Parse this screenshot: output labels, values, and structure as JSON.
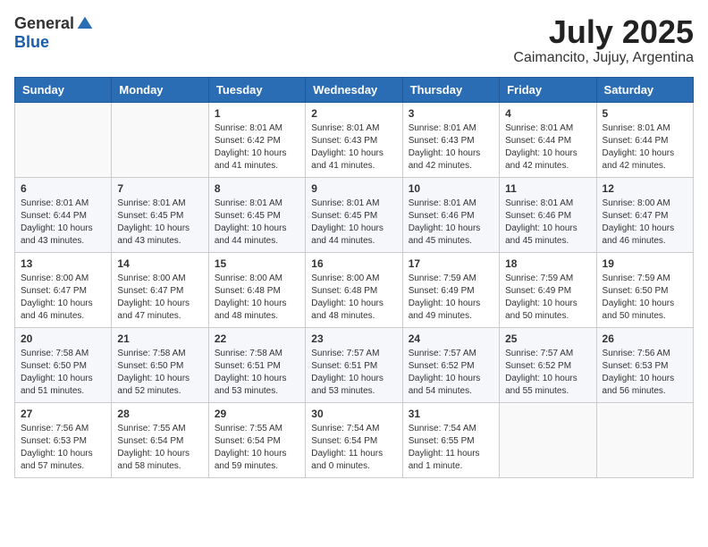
{
  "logo": {
    "general": "General",
    "blue": "Blue"
  },
  "title": "July 2025",
  "subtitle": "Caimancito, Jujuy, Argentina",
  "days_of_week": [
    "Sunday",
    "Monday",
    "Tuesday",
    "Wednesday",
    "Thursday",
    "Friday",
    "Saturday"
  ],
  "weeks": [
    [
      {
        "day": "",
        "info": ""
      },
      {
        "day": "",
        "info": ""
      },
      {
        "day": "1",
        "info": "Sunrise: 8:01 AM\nSunset: 6:42 PM\nDaylight: 10 hours and 41 minutes."
      },
      {
        "day": "2",
        "info": "Sunrise: 8:01 AM\nSunset: 6:43 PM\nDaylight: 10 hours and 41 minutes."
      },
      {
        "day": "3",
        "info": "Sunrise: 8:01 AM\nSunset: 6:43 PM\nDaylight: 10 hours and 42 minutes."
      },
      {
        "day": "4",
        "info": "Sunrise: 8:01 AM\nSunset: 6:44 PM\nDaylight: 10 hours and 42 minutes."
      },
      {
        "day": "5",
        "info": "Sunrise: 8:01 AM\nSunset: 6:44 PM\nDaylight: 10 hours and 42 minutes."
      }
    ],
    [
      {
        "day": "6",
        "info": "Sunrise: 8:01 AM\nSunset: 6:44 PM\nDaylight: 10 hours and 43 minutes."
      },
      {
        "day": "7",
        "info": "Sunrise: 8:01 AM\nSunset: 6:45 PM\nDaylight: 10 hours and 43 minutes."
      },
      {
        "day": "8",
        "info": "Sunrise: 8:01 AM\nSunset: 6:45 PM\nDaylight: 10 hours and 44 minutes."
      },
      {
        "day": "9",
        "info": "Sunrise: 8:01 AM\nSunset: 6:45 PM\nDaylight: 10 hours and 44 minutes."
      },
      {
        "day": "10",
        "info": "Sunrise: 8:01 AM\nSunset: 6:46 PM\nDaylight: 10 hours and 45 minutes."
      },
      {
        "day": "11",
        "info": "Sunrise: 8:01 AM\nSunset: 6:46 PM\nDaylight: 10 hours and 45 minutes."
      },
      {
        "day": "12",
        "info": "Sunrise: 8:00 AM\nSunset: 6:47 PM\nDaylight: 10 hours and 46 minutes."
      }
    ],
    [
      {
        "day": "13",
        "info": "Sunrise: 8:00 AM\nSunset: 6:47 PM\nDaylight: 10 hours and 46 minutes."
      },
      {
        "day": "14",
        "info": "Sunrise: 8:00 AM\nSunset: 6:47 PM\nDaylight: 10 hours and 47 minutes."
      },
      {
        "day": "15",
        "info": "Sunrise: 8:00 AM\nSunset: 6:48 PM\nDaylight: 10 hours and 48 minutes."
      },
      {
        "day": "16",
        "info": "Sunrise: 8:00 AM\nSunset: 6:48 PM\nDaylight: 10 hours and 48 minutes."
      },
      {
        "day": "17",
        "info": "Sunrise: 7:59 AM\nSunset: 6:49 PM\nDaylight: 10 hours and 49 minutes."
      },
      {
        "day": "18",
        "info": "Sunrise: 7:59 AM\nSunset: 6:49 PM\nDaylight: 10 hours and 50 minutes."
      },
      {
        "day": "19",
        "info": "Sunrise: 7:59 AM\nSunset: 6:50 PM\nDaylight: 10 hours and 50 minutes."
      }
    ],
    [
      {
        "day": "20",
        "info": "Sunrise: 7:58 AM\nSunset: 6:50 PM\nDaylight: 10 hours and 51 minutes."
      },
      {
        "day": "21",
        "info": "Sunrise: 7:58 AM\nSunset: 6:50 PM\nDaylight: 10 hours and 52 minutes."
      },
      {
        "day": "22",
        "info": "Sunrise: 7:58 AM\nSunset: 6:51 PM\nDaylight: 10 hours and 53 minutes."
      },
      {
        "day": "23",
        "info": "Sunrise: 7:57 AM\nSunset: 6:51 PM\nDaylight: 10 hours and 53 minutes."
      },
      {
        "day": "24",
        "info": "Sunrise: 7:57 AM\nSunset: 6:52 PM\nDaylight: 10 hours and 54 minutes."
      },
      {
        "day": "25",
        "info": "Sunrise: 7:57 AM\nSunset: 6:52 PM\nDaylight: 10 hours and 55 minutes."
      },
      {
        "day": "26",
        "info": "Sunrise: 7:56 AM\nSunset: 6:53 PM\nDaylight: 10 hours and 56 minutes."
      }
    ],
    [
      {
        "day": "27",
        "info": "Sunrise: 7:56 AM\nSunset: 6:53 PM\nDaylight: 10 hours and 57 minutes."
      },
      {
        "day": "28",
        "info": "Sunrise: 7:55 AM\nSunset: 6:54 PM\nDaylight: 10 hours and 58 minutes."
      },
      {
        "day": "29",
        "info": "Sunrise: 7:55 AM\nSunset: 6:54 PM\nDaylight: 10 hours and 59 minutes."
      },
      {
        "day": "30",
        "info": "Sunrise: 7:54 AM\nSunset: 6:54 PM\nDaylight: 11 hours and 0 minutes."
      },
      {
        "day": "31",
        "info": "Sunrise: 7:54 AM\nSunset: 6:55 PM\nDaylight: 11 hours and 1 minute."
      },
      {
        "day": "",
        "info": ""
      },
      {
        "day": "",
        "info": ""
      }
    ]
  ]
}
